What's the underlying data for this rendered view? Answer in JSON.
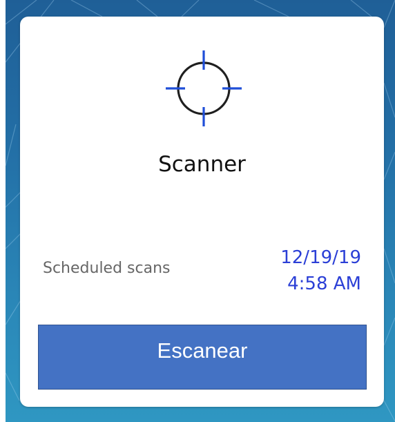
{
  "card": {
    "icon": "crosshair-icon",
    "title": "Scanner",
    "scheduled_label": "Scheduled scans",
    "scheduled_date": "12/19/19",
    "scheduled_time": "4:58 AM",
    "action_button": "Escanear"
  },
  "colors": {
    "background_top": "#1f5f97",
    "background_bottom": "#2f97c2",
    "card": "#ffffff",
    "button": "#4472c4",
    "date_text": "#2b3fd6",
    "crosshair_ticks": "#1f4ed8"
  }
}
